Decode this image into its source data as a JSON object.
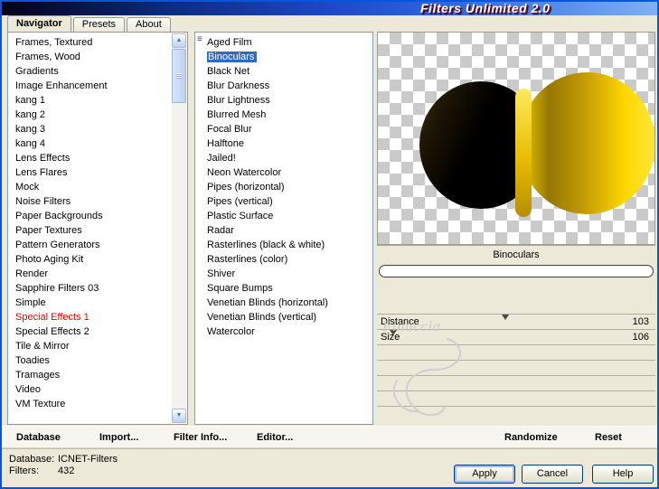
{
  "window": {
    "title": "Filters Unlimited 2.0"
  },
  "tabs": [
    {
      "label": "Navigator",
      "active": true
    },
    {
      "label": "Presets",
      "active": false
    },
    {
      "label": "About",
      "active": false
    }
  ],
  "categories": {
    "items": [
      "Frames, Textured",
      "Frames, Wood",
      "Gradients",
      "Image Enhancement",
      "kang 1",
      "kang 2",
      "kang 3",
      "kang 4",
      "Lens Effects",
      "Lens Flares",
      "Mock",
      "Noise Filters",
      "Paper Backgrounds",
      "Paper Textures",
      "Pattern Generators",
      "Photo Aging Kit",
      "Render",
      "Sapphire Filters 03",
      "Simple",
      "Special Effects 1",
      "Special Effects 2",
      "Tile & Mirror",
      "Toadies",
      "Tramages",
      "Video",
      "VM Texture"
    ],
    "selected": "Special Effects 1"
  },
  "filters": {
    "items": [
      "Aged Film",
      "Binoculars",
      "Black Net",
      "Blur Darkness",
      "Blur Lightness",
      "Blurred Mesh",
      "Focal Blur",
      "Halftone",
      "Jailed!",
      "Neon Watercolor",
      "Pipes (horizontal)",
      "Pipes (vertical)",
      "Plastic Surface",
      "Radar",
      "Rasterlines (black & white)",
      "Rasterlines (color)",
      "Shiver",
      "Square Bumps",
      "Venetian Blinds (horizontal)",
      "Venetian Blinds (vertical)",
      "Watercolor"
    ],
    "selected": "Binoculars"
  },
  "preview": {
    "filter_name": "Binoculars"
  },
  "parameters": [
    {
      "name": "Distance",
      "value": 103,
      "slider_pct": 46
    },
    {
      "name": "Size",
      "value": 106,
      "slider_pct": 6
    }
  ],
  "empty_parameter_rows": 5,
  "toolbar": {
    "database": "Database",
    "import": "Import...",
    "filter_info": "Filter Info...",
    "editor": "Editor...",
    "randomize": "Randomize",
    "reset": "Reset"
  },
  "status": {
    "database_label": "Database:",
    "database_value": "ICNET-Filters",
    "filters_label": "Filters:",
    "filters_value": "432"
  },
  "actions": {
    "apply": "Apply",
    "cancel": "Cancel",
    "help": "Help"
  },
  "watermark": {
    "text": "Finuccia"
  },
  "icons": {
    "scroll_up_icon": "▲",
    "scroll_down_icon": "▼",
    "grip_icon": "≡"
  },
  "colors": {
    "selection_blue": "#316AC5",
    "selected_category_red": "#DE0000",
    "titlebar_blue": "#2F6AE0",
    "lens_gold": "#FFD800",
    "lens_dark": "#000000",
    "window_gray": "#ECE9D8"
  }
}
